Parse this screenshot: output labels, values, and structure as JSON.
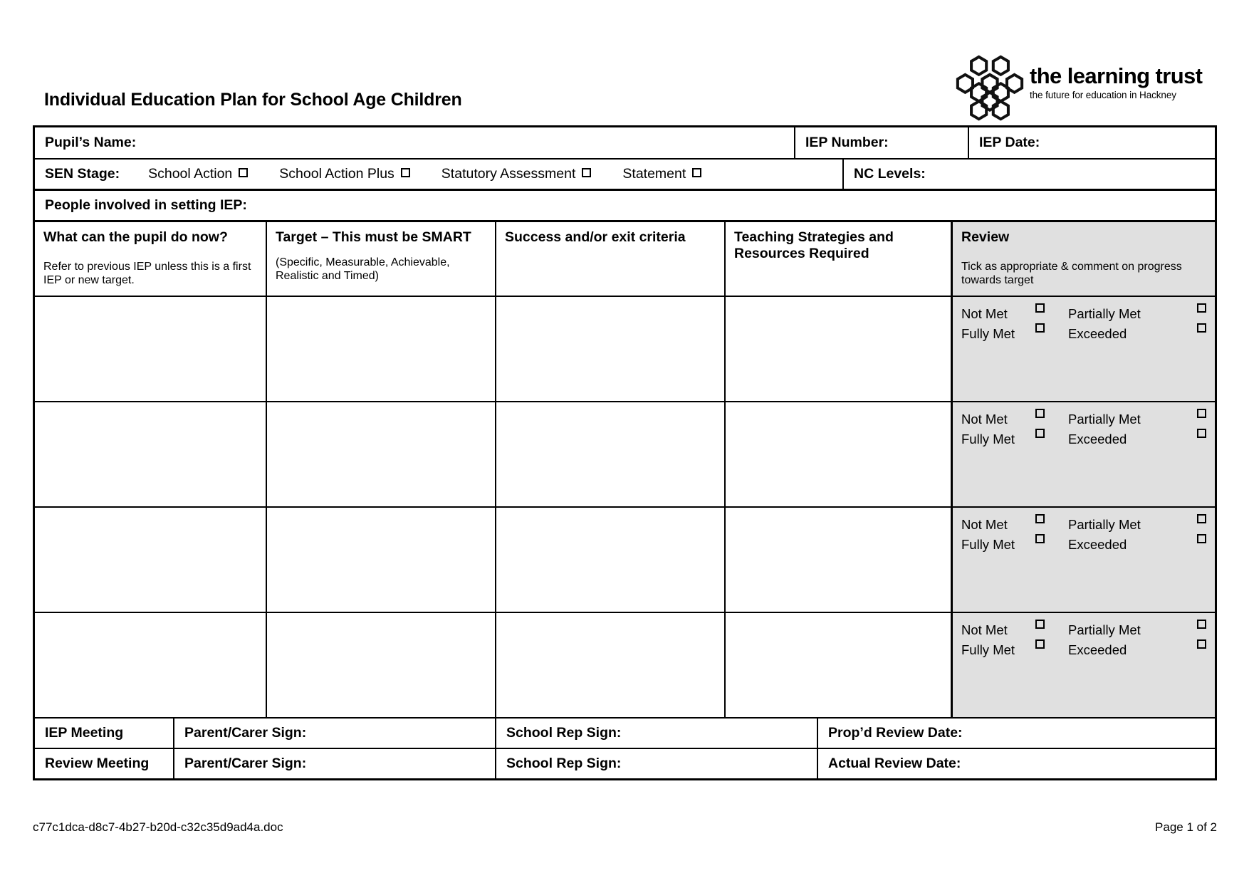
{
  "document": {
    "title": "Individual Education Plan for School Age Children"
  },
  "logo": {
    "mark": "honeycomb-hexagons",
    "name": "the learning trust",
    "tagline": "the future for education in Hackney"
  },
  "identity_row": {
    "pupil_name_label": "Pupil’s Name:",
    "pupil_name_value": "",
    "iep_number_label": "IEP Number:",
    "iep_number_value": "",
    "iep_date_label": "IEP Date:",
    "iep_date_value": ""
  },
  "sen_stage": {
    "label": "SEN Stage:",
    "options": [
      {
        "label": "School Action",
        "checked": false
      },
      {
        "label": "School Action Plus",
        "checked": false
      },
      {
        "label": "Statutory Assessment",
        "checked": false
      },
      {
        "label": "Statement",
        "checked": false
      }
    ],
    "nc_levels_label": "NC Levels:",
    "nc_levels_value": ""
  },
  "people_involved": {
    "label": "People involved in setting IEP:",
    "value": ""
  },
  "columns": [
    {
      "title": "What can the pupil do now?",
      "subtitle": "Refer to previous IEP unless this is a first IEP or new target."
    },
    {
      "title": "Target – This must be SMART",
      "subtitle": "(Specific, Measurable, Achievable, Realistic and Timed)"
    },
    {
      "title": "Success and/or exit criteria",
      "subtitle": ""
    },
    {
      "title": "Teaching Strategies and Resources Required",
      "subtitle": ""
    },
    {
      "title": "Review",
      "subtitle": "Tick as appropriate & comment on progress towards target"
    }
  ],
  "review_options": {
    "not_met": "Not Met",
    "partially_met": "Partially Met",
    "fully_met": "Fully Met",
    "exceeded": "Exceeded"
  },
  "body_rows": [
    {
      "what": "",
      "target": "",
      "success": "",
      "teaching": "",
      "review": {
        "not_met": false,
        "partially_met": false,
        "fully_met": false,
        "exceeded": false
      }
    },
    {
      "what": "",
      "target": "",
      "success": "",
      "teaching": "",
      "review": {
        "not_met": false,
        "partially_met": false,
        "fully_met": false,
        "exceeded": false
      }
    },
    {
      "what": "",
      "target": "",
      "success": "",
      "teaching": "",
      "review": {
        "not_met": false,
        "partially_met": false,
        "fully_met": false,
        "exceeded": false
      }
    },
    {
      "what": "",
      "target": "",
      "success": "",
      "teaching": "",
      "review": {
        "not_met": false,
        "partially_met": false,
        "fully_met": false,
        "exceeded": false
      }
    }
  ],
  "signature_rows": [
    {
      "meeting_label": "IEP Meeting",
      "parent_label": "Parent/Carer Sign:",
      "parent_value": "",
      "school_label": "School Rep Sign:",
      "school_value": "",
      "date_label": "Prop’d Review Date:",
      "date_value": ""
    },
    {
      "meeting_label": "Review Meeting",
      "parent_label": "Parent/Carer Sign:",
      "parent_value": "",
      "school_label": "School Rep Sign:",
      "school_value": "",
      "date_label": "Actual Review Date:",
      "date_value": ""
    }
  ],
  "footer": {
    "filename": "c77c1dca-d8c7-4b27-b20d-c32c35d9ad4a.doc",
    "page": "Page 1 of 2"
  },
  "colors": {
    "review_background": "#e0e0e0",
    "border": "#000000",
    "text": "#000000",
    "page": "#ffffff"
  }
}
